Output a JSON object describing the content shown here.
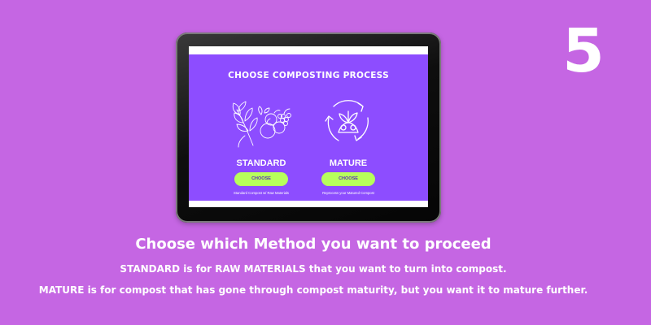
{
  "step": {
    "number": "5"
  },
  "app": {
    "title": "CHOOSE COMPOSTING PROCESS",
    "options": [
      {
        "label": "STANDARD",
        "button": "CHOOSE",
        "description": "Standard Compost w/ Raw Materials",
        "illustration": "fruits-herbs-illustration"
      },
      {
        "label": "MATURE",
        "button": "CHOOSE",
        "description": "Reprocess your Matured Compost",
        "illustration": "recycle-produce-icon"
      }
    ]
  },
  "caption": {
    "heading": "Choose which Method you want to proceed",
    "line1": "STANDARD is for RAW MATERIALS that you want to turn into compost.",
    "line2": "MATURE is for compost that has gone through compost maturity, but you want it to mature further."
  },
  "colors": {
    "background": "#c566e3",
    "app_panel": "#8d4dff",
    "button": "#b7ff5b",
    "button_text": "#5a2fb8",
    "text": "#ffffff"
  }
}
